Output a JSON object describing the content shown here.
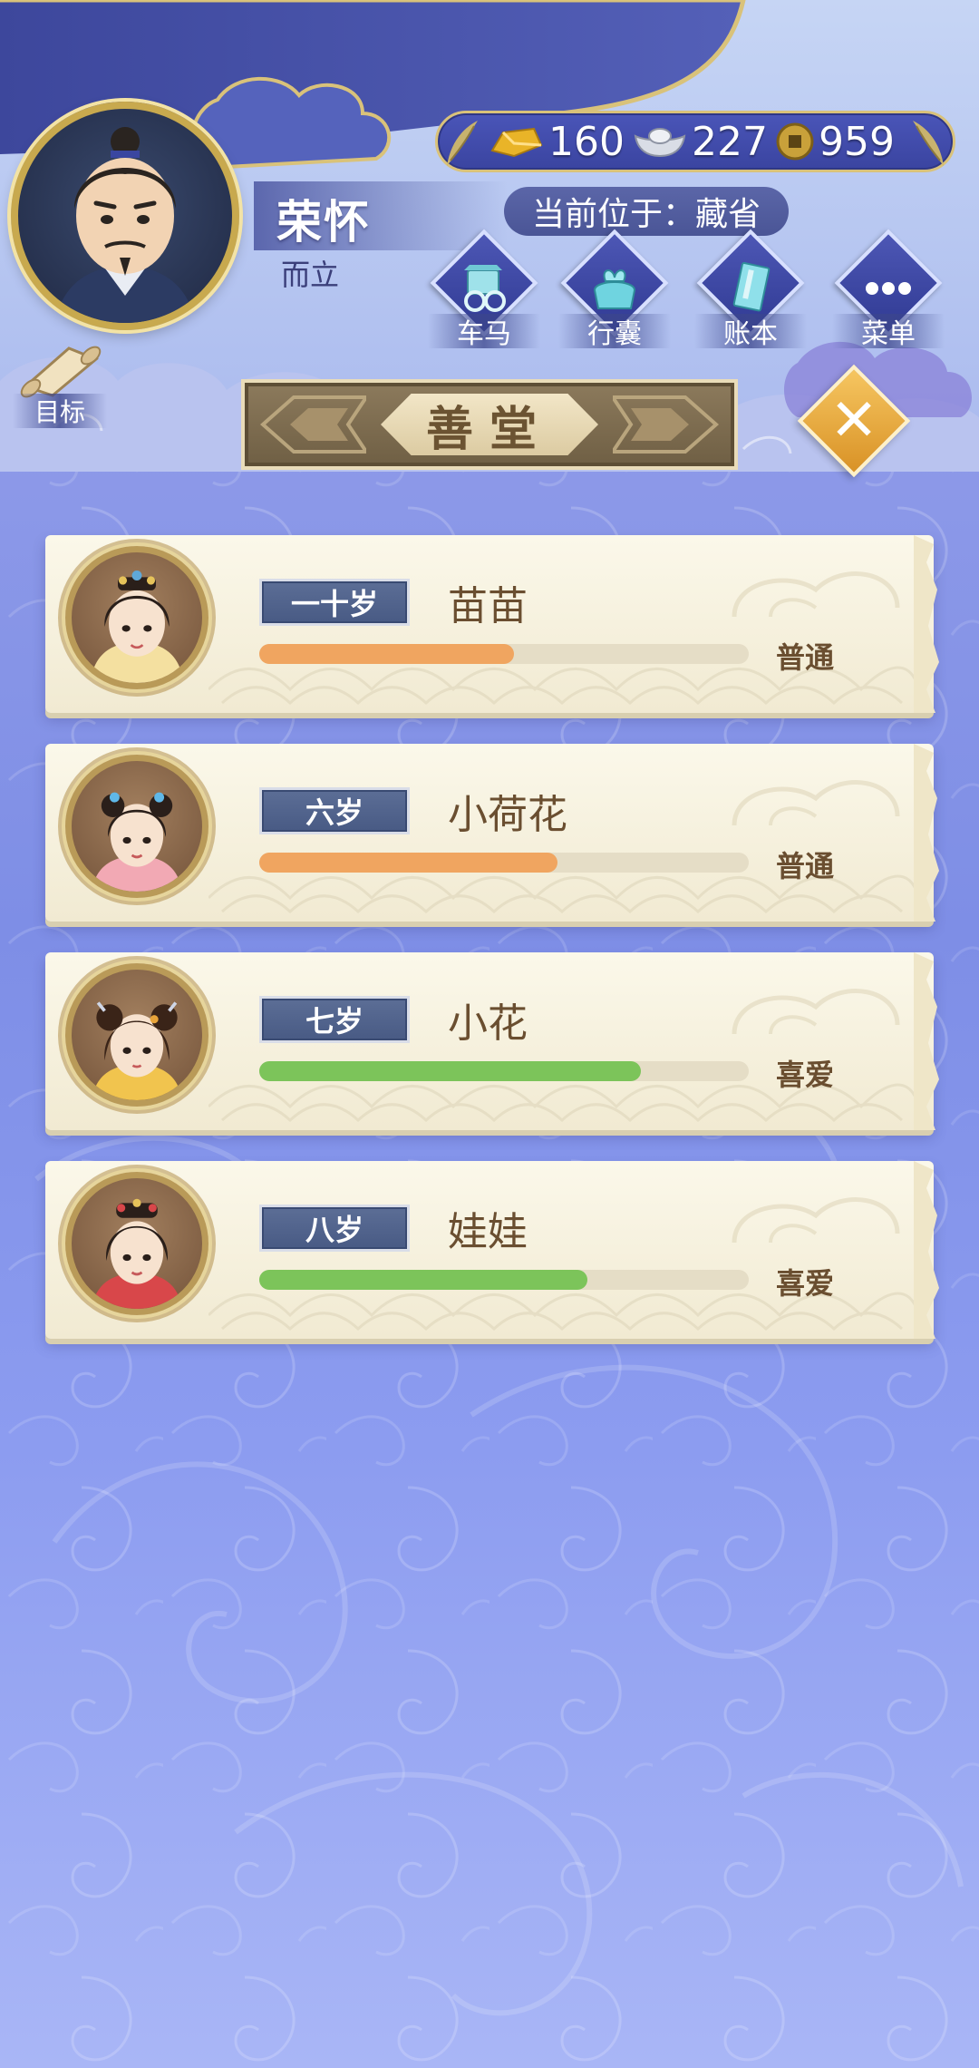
{
  "player": {
    "name": "荣怀",
    "title": "而立"
  },
  "currency": [
    {
      "icon": "gold-ingot-icon",
      "amount": "160"
    },
    {
      "icon": "silver-ingot-icon",
      "amount": "227"
    },
    {
      "icon": "copper-coin-icon",
      "amount": "959"
    }
  ],
  "location": "当前位于：藏省",
  "nav": [
    {
      "id": "carriage",
      "label": "车马",
      "icon": "carriage-icon"
    },
    {
      "id": "luggage",
      "label": "行囊",
      "icon": "bundle-icon"
    },
    {
      "id": "ledger",
      "label": "账本",
      "icon": "ledger-icon"
    },
    {
      "id": "menu",
      "label": "菜单",
      "icon": "more-dots-icon"
    }
  ],
  "goal": {
    "label": "目标",
    "icon": "scroll-icon"
  },
  "panel": {
    "title": "善堂",
    "close_icon": "close-icon"
  },
  "children": [
    {
      "age": "一十岁",
      "name": "苗苗",
      "progress": 0.52,
      "status": "普通",
      "bar_color": "#f0a560"
    },
    {
      "age": "六岁",
      "name": "小荷花",
      "progress": 0.61,
      "status": "普通",
      "bar_color": "#f0a560"
    },
    {
      "age": "七岁",
      "name": "小花",
      "progress": 0.78,
      "status": "喜爱",
      "bar_color": "#7cc45a"
    },
    {
      "age": "八岁",
      "name": "娃娃",
      "progress": 0.67,
      "status": "喜爱",
      "bar_color": "#7cc45a"
    }
  ],
  "colors": {
    "accent_gold": "#d9c27a",
    "panel_blue": "#3a44a0",
    "card_bg": "#f6f1de"
  }
}
